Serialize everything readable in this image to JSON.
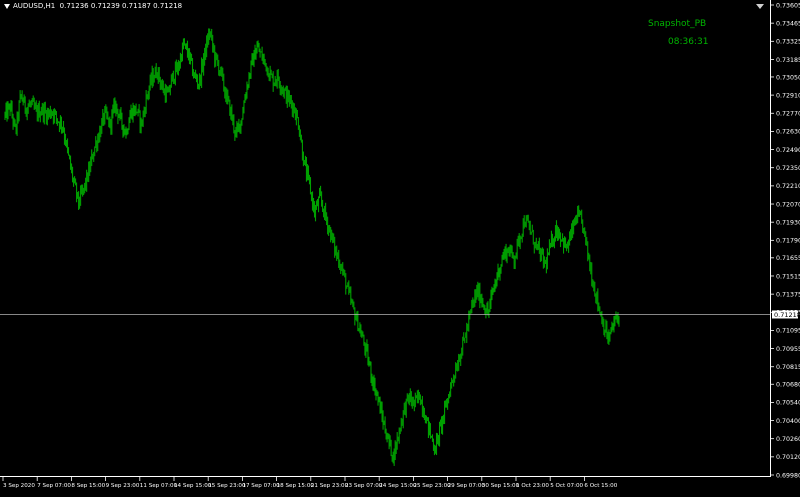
{
  "window": {
    "symbol_label": "AUDUSD,H1",
    "ohlc": "0.71236 0.71239 0.71187 0.71218"
  },
  "overlay": {
    "name": "Snapshot_PB",
    "time": "08:36:31"
  },
  "current_price": "0.71218",
  "colors": {
    "background": "#000000",
    "candle": "#00a000",
    "axis": "#ffffff",
    "overlay_text": "#00b400"
  },
  "chart_data": {
    "type": "line",
    "y_ticks": [
      "0.73605",
      "0.73465",
      "0.73325",
      "0.73185",
      "0.73050",
      "0.72910",
      "0.72770",
      "0.72630",
      "0.72490",
      "0.72350",
      "0.72210",
      "0.72070",
      "0.71930",
      "0.71790",
      "0.71655",
      "0.71515",
      "0.71375",
      "0.71235",
      "0.71095",
      "0.70955",
      "0.70815",
      "0.70680",
      "0.70540",
      "0.70400",
      "0.70260",
      "0.70120",
      "0.69980"
    ],
    "ylim": [
      0.6998,
      0.73605
    ],
    "x_ticks": [
      "3 Sep 2020",
      "7 Sep 07:00",
      "8 Sep 15:00",
      "9 Sep 23:00",
      "11 Sep 07:00",
      "14 Sep 15:00",
      "15 Sep 23:00",
      "17 Sep 07:00",
      "18 Sep 15:00",
      "21 Sep 23:00",
      "23 Sep 07:00",
      "24 Sep 15:00",
      "25 Sep 23:00",
      "29 Sep 07:00",
      "30 Sep 15:00",
      "1 Oct 23:00",
      "5 Oct 07:00",
      "6 Oct 15:00"
    ],
    "series": [
      {
        "values": [
          0.7275,
          0.7282,
          0.7262,
          0.7291,
          0.7281,
          0.7284,
          0.7277,
          0.728,
          0.7276,
          0.7279,
          0.7272,
          0.7268,
          0.7245,
          0.7225,
          0.7208,
          0.7218,
          0.7232,
          0.725,
          0.7262,
          0.7276,
          0.7268,
          0.7284,
          0.7272,
          0.7262,
          0.7278,
          0.728,
          0.7268,
          0.729,
          0.7304,
          0.731,
          0.7296,
          0.729,
          0.7306,
          0.7312,
          0.733,
          0.7322,
          0.7306,
          0.73,
          0.7322,
          0.734,
          0.732,
          0.731,
          0.7292,
          0.7278,
          0.726,
          0.7272,
          0.7296,
          0.7315,
          0.7328,
          0.732,
          0.7312,
          0.7302,
          0.7305,
          0.7295,
          0.7288,
          0.7282,
          0.7268,
          0.7238,
          0.7222,
          0.72,
          0.7212,
          0.7198,
          0.7185,
          0.717,
          0.716,
          0.7145,
          0.713,
          0.7118,
          0.7105,
          0.709,
          0.7072,
          0.7058,
          0.704,
          0.7025,
          0.7012,
          0.703,
          0.7048,
          0.7058,
          0.7052,
          0.706,
          0.7045,
          0.703,
          0.7018,
          0.7035,
          0.705,
          0.7068,
          0.7082,
          0.7095,
          0.711,
          0.7128,
          0.714,
          0.7132,
          0.7122,
          0.714,
          0.7155,
          0.7168,
          0.7172,
          0.7165,
          0.718,
          0.7195,
          0.7188,
          0.7176,
          0.7168,
          0.716,
          0.7175,
          0.7188,
          0.7182,
          0.7172,
          0.7185,
          0.7198,
          0.7192,
          0.717,
          0.7148,
          0.713,
          0.7115,
          0.7102,
          0.7115,
          0.7121
        ]
      }
    ]
  }
}
